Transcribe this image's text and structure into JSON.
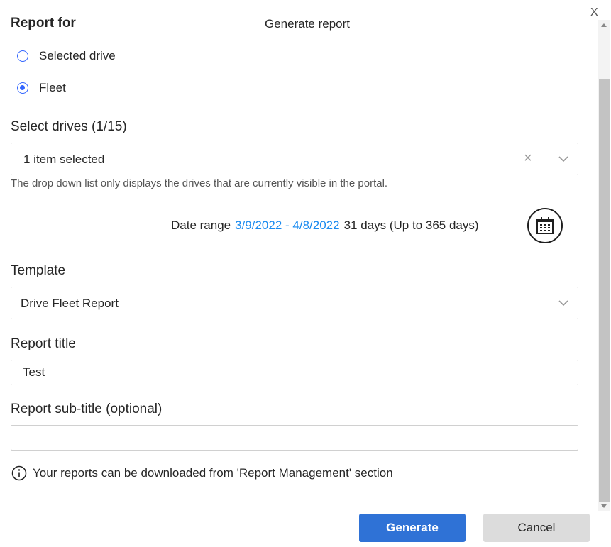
{
  "dialog": {
    "title": "Generate report",
    "close_label": "X"
  },
  "report_for": {
    "label": "Report for",
    "options": [
      {
        "label": "Selected drive",
        "checked": false
      },
      {
        "label": "Fleet",
        "checked": true
      }
    ]
  },
  "select_drives": {
    "label": "Select drives (1/15)",
    "value": "1 item selected",
    "clear_label": "×",
    "hint": "The drop down list only displays the drives that are currently visible in the portal."
  },
  "date_range": {
    "label": "Date range",
    "value": "3/9/2022 - 4/8/2022",
    "note": "31 days (Up to 365 days)",
    "icon": "calendar-icon"
  },
  "template": {
    "label": "Template",
    "value": "Drive Fleet Report"
  },
  "report_title": {
    "label": "Report title",
    "value": "Test"
  },
  "report_subtitle": {
    "label": "Report sub-title (optional)",
    "value": ""
  },
  "info": {
    "icon": "info-icon",
    "text": "Your reports can be downloaded from 'Report Management' section"
  },
  "buttons": {
    "generate": "Generate",
    "cancel": "Cancel"
  },
  "colors": {
    "accent": "#3366ff",
    "link": "#1a8bf0",
    "primary_button": "#2f72d6",
    "secondary_button": "#dcdcdc"
  }
}
